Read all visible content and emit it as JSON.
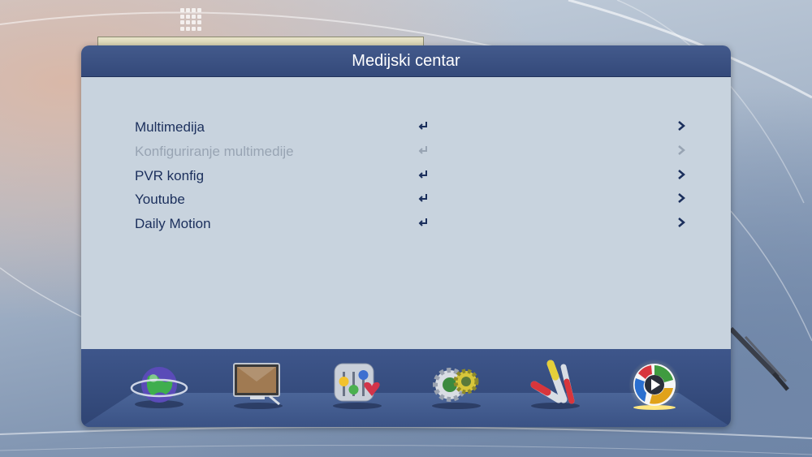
{
  "title": "Medijski centar",
  "menu": [
    {
      "label": "Multimedija",
      "enabled": true
    },
    {
      "label": "Konfiguriranje multimedije",
      "enabled": false
    },
    {
      "label": "PVR konfig",
      "enabled": true
    },
    {
      "label": "Youtube",
      "enabled": true
    },
    {
      "label": "Daily Motion",
      "enabled": true
    }
  ],
  "categories": [
    {
      "icon": "globe-icon",
      "selected": false
    },
    {
      "icon": "monitor-icon",
      "selected": false
    },
    {
      "icon": "settings-sliders-icon",
      "selected": false
    },
    {
      "icon": "gears-icon",
      "selected": false
    },
    {
      "icon": "av-cables-icon",
      "selected": false
    },
    {
      "icon": "media-play-icon",
      "selected": true
    }
  ],
  "colors": {
    "header": "#3b5185",
    "body": "#c8d3de",
    "text": "#1b2f5c",
    "disabled_text": "#98a4b3",
    "selected_glow": "#ffe680"
  }
}
